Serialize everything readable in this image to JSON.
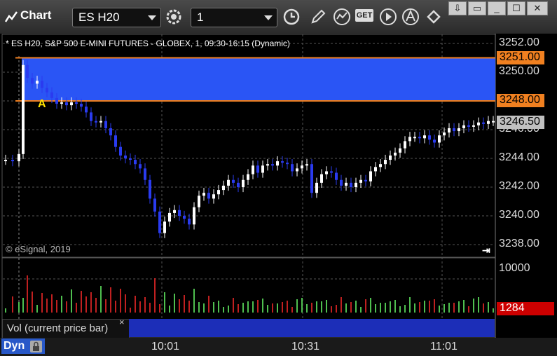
{
  "window": {
    "title": "Chart",
    "symbol_value": "ES H20",
    "interval_value": "1",
    "get_label": "GET"
  },
  "chart": {
    "info_line": "* ES H20, S&P 500 E-MINI FUTURES - GLOBEX, 1, 09:30-16:15 (Dynamic)",
    "copyright": "© eSignal, 2019",
    "marker_label": "A",
    "colors": {
      "zone_fill": "#2a55f5",
      "zone_line": "#f08020",
      "up_candle": "#ffffff",
      "down_candle": "#2a3bf0",
      "volume_up": "#4fbf4f",
      "volume_down": "#c02020",
      "current_price_badge": "#c0c0c0",
      "volume_badge": "#cc0000"
    },
    "price_axis": [
      "3252.00",
      "3250.00",
      "3248.00",
      "3246.00",
      "3244.00",
      "3242.00",
      "3240.00",
      "3238.00"
    ],
    "zone_high_label": "3251.00",
    "zone_low_label": "3248.00",
    "current_price_label": "3246.50",
    "time_axis": [
      "10:01",
      "10:31",
      "11:01"
    ]
  },
  "volume": {
    "label": "Vol (current price bar)",
    "close_label": "×",
    "axis_label": "10000",
    "current_label": "1284"
  },
  "footer": {
    "dyn_label": "Dyn"
  }
}
